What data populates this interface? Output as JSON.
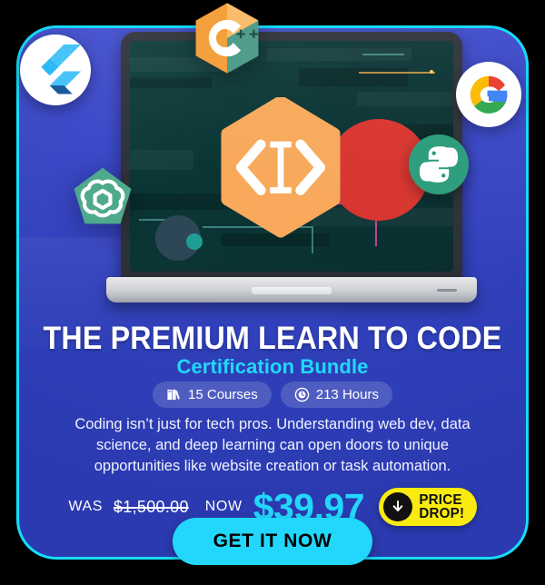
{
  "card": {
    "accent_cyan": "#22D7FB",
    "background_blue": "#2F3FB8",
    "border_color": "#17DCFB"
  },
  "hero": {
    "laptop_alt": "macbook-laptop",
    "screen": {
      "background_color": "#0B3535",
      "code_icon_color": "#F8A95B",
      "accent_circle_color": "#D8352F"
    },
    "logos": [
      {
        "name": "flutter",
        "label": "Flutter"
      },
      {
        "name": "cpp",
        "label": "C++"
      },
      {
        "name": "google",
        "label": "Google"
      },
      {
        "name": "python",
        "label": "Python"
      },
      {
        "name": "openai",
        "label": "OpenAI"
      }
    ]
  },
  "headline": "THE PREMIUM LEARN TO CODE",
  "subhead": "Certification Bundle",
  "badges": [
    {
      "icon": "books-icon",
      "label": "15 Courses"
    },
    {
      "icon": "clock-icon",
      "label": "213 Hours"
    }
  ],
  "description": "Coding isn’t just for tech pros. Understanding web dev, data science, and deep learning can open doors to unique opportunities like website creation or task automation.",
  "pricing": {
    "was_label": "WAS",
    "was_value": "$1,500.00",
    "now_label": "NOW",
    "now_value": "$39.97",
    "badge_line1": "PRICE",
    "badge_line2": "DROP!",
    "badge_color": "#F9EB10"
  },
  "cta": {
    "label": "GET IT NOW"
  }
}
